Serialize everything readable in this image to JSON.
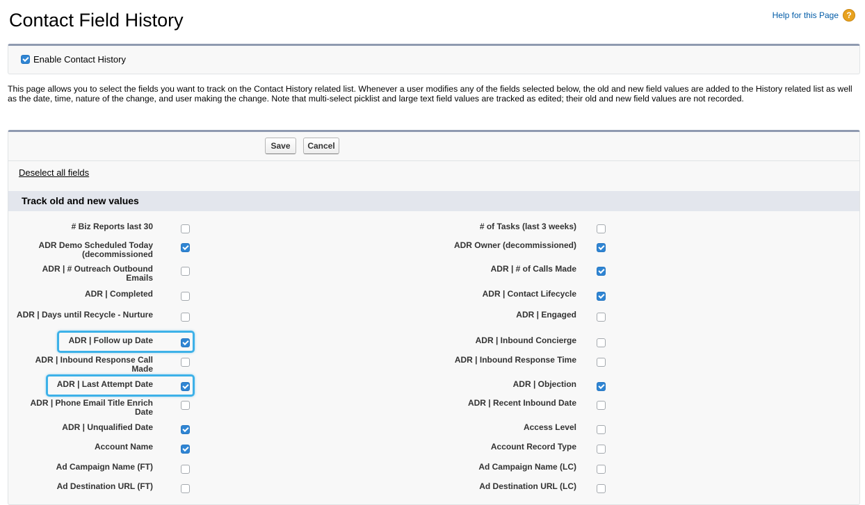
{
  "page": {
    "title": "Contact Field History",
    "help_label": "Help for this Page",
    "help_icon": "?"
  },
  "enable": {
    "label": "Enable Contact History",
    "checked": true
  },
  "description": "This page allows you to select the fields you want to track on the Contact History related list. Whenever a user modifies any of the fields selected below, the old and new field values are added to the History related list as well as the date, time, nature of the change, and user making the change. Note that multi-select picklist and large text field values are tracked as edited; their old and new field values are not recorded.",
  "toolbar": {
    "save_label": "Save",
    "cancel_label": "Cancel"
  },
  "deselect_label": "Deselect all fields",
  "section": {
    "title": "Track old and new values"
  },
  "fields_left": [
    {
      "label": "# Biz Reports last 30",
      "checked": false
    },
    {
      "label": "ADR Demo Scheduled Today (decommissioned",
      "checked": true
    },
    {
      "label": "ADR | # Outreach Outbound Emails",
      "checked": false
    },
    {
      "label": "ADR | Completed",
      "checked": false
    },
    {
      "label": "ADR | Days until Recycle - Nurture",
      "checked": false
    },
    {
      "label": "ADR | Follow up Date",
      "checked": true,
      "highlighted": true
    },
    {
      "label": "ADR | Inbound Response Call Made",
      "checked": false
    },
    {
      "label": "ADR | Last Attempt Date",
      "checked": true,
      "highlighted": true
    },
    {
      "label": "ADR | Phone Email Title Enrich Date",
      "checked": false
    },
    {
      "label": "ADR | Unqualified Date",
      "checked": true
    },
    {
      "label": "Account Name",
      "checked": true
    },
    {
      "label": "Ad Campaign Name (FT)",
      "checked": false
    },
    {
      "label": "Ad Destination URL (FT)",
      "checked": false
    }
  ],
  "fields_right": [
    {
      "label": "# of Tasks (last 3 weeks)",
      "checked": false
    },
    {
      "label": "ADR Owner (decommissioned)",
      "checked": true
    },
    {
      "label": "ADR | # of Calls Made",
      "checked": true
    },
    {
      "label": "ADR | Contact Lifecycle",
      "checked": true
    },
    {
      "label": "ADR | Engaged",
      "checked": false
    },
    {
      "label": "ADR | Inbound Concierge",
      "checked": false
    },
    {
      "label": "ADR | Inbound Response Time",
      "checked": false
    },
    {
      "label": "ADR | Objection",
      "checked": true
    },
    {
      "label": "ADR | Recent Inbound Date",
      "checked": false
    },
    {
      "label": "Access Level",
      "checked": false
    },
    {
      "label": "Account Record Type",
      "checked": false
    },
    {
      "label": "Ad Campaign Name (LC)",
      "checked": false
    },
    {
      "label": "Ad Destination URL (LC)",
      "checked": false
    }
  ],
  "colors": {
    "checkbox_checked": "#2f85d3",
    "highlight": "#3db1e8",
    "section_bg": "#e3e6ed",
    "link": "#015ba7"
  }
}
